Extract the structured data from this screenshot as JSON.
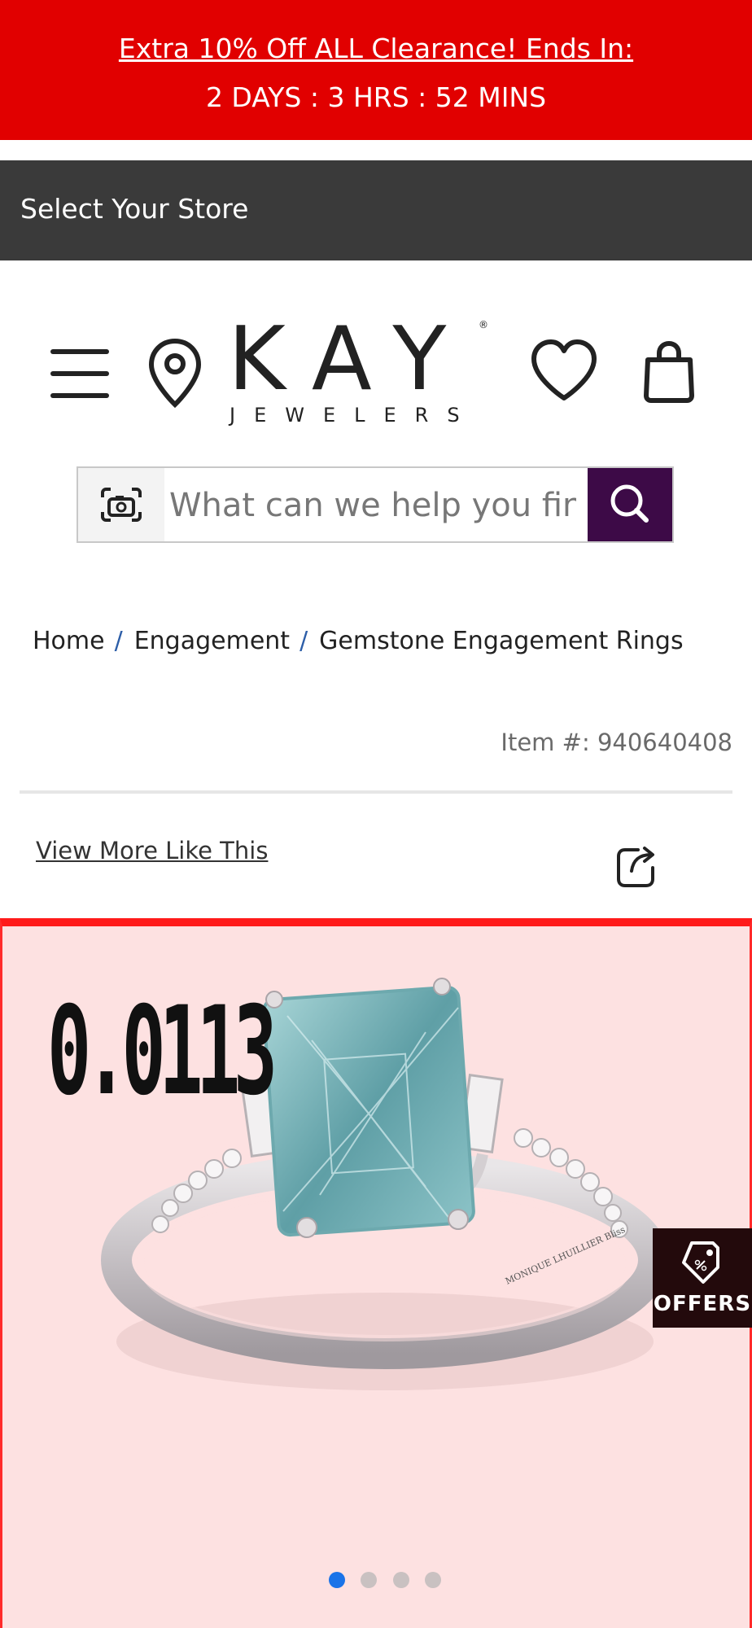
{
  "promo": {
    "headline": "Extra 10% Off ALL Clearance! Ends In:",
    "countdown": "2 DAYS : 3  HRS : 52 MINS"
  },
  "store_bar": {
    "label": "Select Your Store"
  },
  "header": {
    "logo_main": "KAY",
    "logo_sub": "JEWELERS",
    "logo_reg": "®",
    "icons": [
      "menu-icon",
      "location-pin-icon",
      "heart-icon",
      "shopping-bag-icon"
    ]
  },
  "search": {
    "placeholder": "What can we help you find?"
  },
  "breadcrumb": {
    "items": [
      "Home",
      "Engagement",
      "Gemstone Engagement Rings"
    ],
    "separator": "/"
  },
  "product": {
    "item_number": "Item #: 940640408",
    "view_more": "View More Like This",
    "image_badge": "0.0113",
    "ring_engraving": "MONIQUE LHUILLIER Bliss",
    "offers_label": "OFFERS"
  },
  "carousel": {
    "dot_count": 4,
    "active_index": 0
  },
  "colors": {
    "promo_bg": "#e10000",
    "store_bar_bg": "#3a3a3a",
    "search_button_bg": "#3d0a47",
    "gallery_bg": "#fde1e1",
    "active_dot": "#1a73e8"
  }
}
